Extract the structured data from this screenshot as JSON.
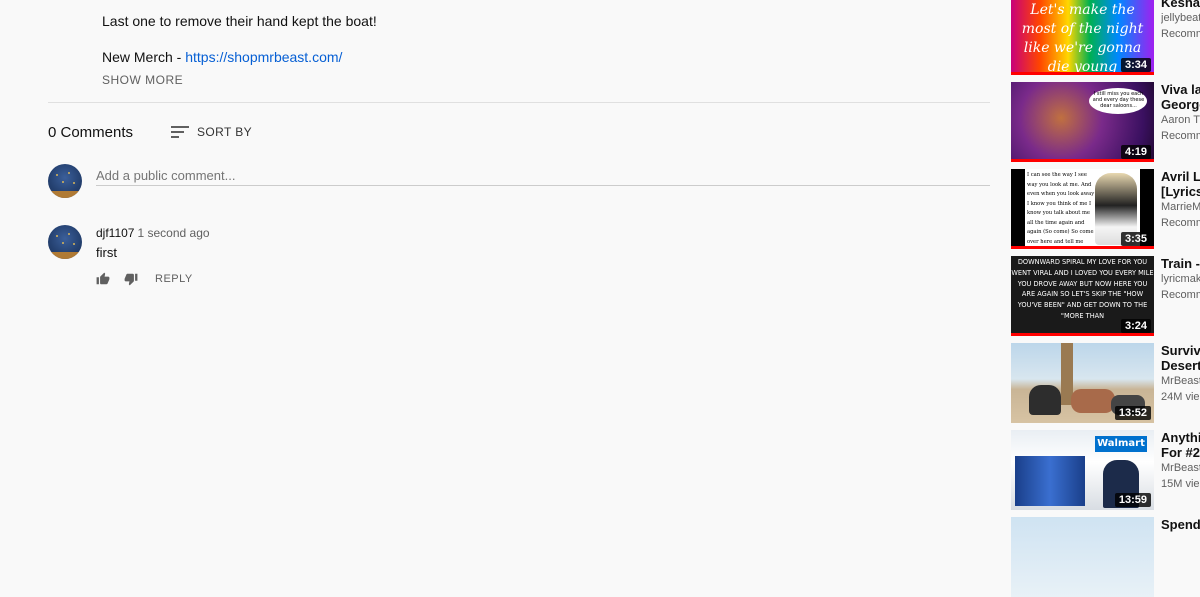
{
  "description": {
    "line1": "Last one to remove their hand kept the boat!",
    "merch_prefix": "New Merch - ",
    "merch_link": "https://shopmrbeast.com/",
    "show_more": "SHOW MORE"
  },
  "comments": {
    "count_label": "0 Comments",
    "sort_label": "SORT BY",
    "add_placeholder": "Add a public comment...",
    "items": [
      {
        "author": "djf1107",
        "time": "1 second ago",
        "text": "first",
        "reply_label": "REPLY"
      }
    ]
  },
  "recommendations": [
    {
      "title": "Kesha -",
      "channel": "jellybeat",
      "meta": "Recomm",
      "duration": "3:34",
      "thumb_text": "Let's make the most of the night like we're gonna die young"
    },
    {
      "title": "Viva la",
      "title2": "George",
      "channel": "Aaron T",
      "meta": "Recomm",
      "duration": "4:19",
      "thumb_text": "I still miss you each and every day these dear saloons..."
    },
    {
      "title": "Avril La",
      "title2": "[Lyrics/",
      "channel": "MarrieM",
      "meta": "Recomm",
      "duration": "3:35",
      "thumb_text": "I can see the way I see way you look at me. And even when you look away I know you think of me I know you talk about me all the time again and again (So come) So come over here and tell me what I wanna hear. Better yet make"
    },
    {
      "title": "Train - I",
      "channel": "lyricmak",
      "meta": "Recomm",
      "duration": "3:24",
      "thumb_text": "DOWNWARD SPIRAL MY LOVE FOR YOU WENT VIRAL AND I LOVED YOU EVERY MILE YOU DROVE AWAY BUT NOW HERE YOU ARE AGAIN SO LET'S SKIP THE \"HOW YOU'VE BEEN\" AND GET DOWN TO THE \"MORE THAN"
    },
    {
      "title": "Survivin",
      "title2": "Deserte",
      "channel": "MrBeast",
      "meta": "24M vie",
      "duration": "13:52"
    },
    {
      "title": "Anythin",
      "title2": "For #2",
      "channel": "MrBeast",
      "meta": "15M vie",
      "duration": "13:59",
      "thumb_text": "Walmart"
    },
    {
      "title": "Spendi"
    }
  ]
}
